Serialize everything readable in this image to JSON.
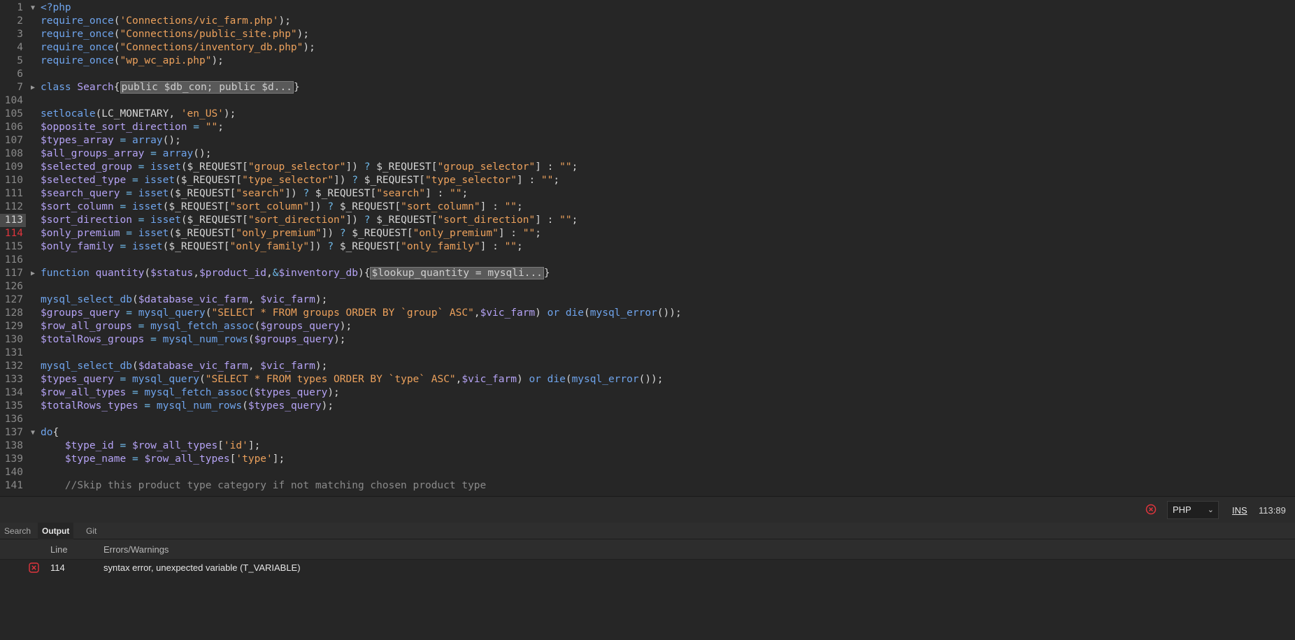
{
  "status_bar": {
    "language": "PHP",
    "mode": "INS",
    "cursor": "113:89"
  },
  "panel_tabs": [
    "Search",
    "Output",
    "Git"
  ],
  "output": {
    "headers": {
      "line": "Line",
      "message": "Errors/Warnings"
    },
    "rows": [
      {
        "line": "114",
        "message": "syntax error, unexpected variable (T_VARIABLE)"
      }
    ]
  },
  "colors": {
    "background": "#262626",
    "keyword": "#6fa4ec",
    "variable": "#b5a3f5",
    "string": "#eca15c",
    "error": "#e0353d"
  },
  "editor": {
    "active_line": "113",
    "error_line": "114",
    "lines": [
      {
        "n": "1",
        "fold": "open",
        "t": [
          [
            "k",
            "<?php"
          ]
        ]
      },
      {
        "n": "2",
        "t": [
          [
            "k",
            "require_once"
          ],
          [
            "p",
            "("
          ],
          [
            "s",
            "'Connections/vic_farm.php'"
          ],
          [
            "p",
            ");"
          ]
        ]
      },
      {
        "n": "3",
        "t": [
          [
            "k",
            "require_once"
          ],
          [
            "p",
            "("
          ],
          [
            "s",
            "\"Connections/public_site.php\""
          ],
          [
            "p",
            ");"
          ]
        ]
      },
      {
        "n": "4",
        "t": [
          [
            "k",
            "require_once"
          ],
          [
            "p",
            "("
          ],
          [
            "s",
            "\"Connections/inventory_db.php\""
          ],
          [
            "p",
            ");"
          ]
        ]
      },
      {
        "n": "5",
        "t": [
          [
            "k",
            "require_once"
          ],
          [
            "p",
            "("
          ],
          [
            "s",
            "\"wp_wc_api.php\""
          ],
          [
            "p",
            ");"
          ]
        ]
      },
      {
        "n": "6",
        "t": []
      },
      {
        "n": "7",
        "fold": "closed",
        "t": [
          [
            "k",
            "class "
          ],
          [
            "v",
            "Search"
          ],
          [
            "p",
            "{"
          ],
          [
            "box",
            "public $db_con; public $d..."
          ],
          [
            "p",
            "}"
          ]
        ]
      },
      {
        "n": "104",
        "t": []
      },
      {
        "n": "105",
        "t": [
          [
            "k",
            "setlocale"
          ],
          [
            "p",
            "(LC_MONETARY, "
          ],
          [
            "s",
            "'en_US'"
          ],
          [
            "p",
            ");"
          ]
        ]
      },
      {
        "n": "106",
        "t": [
          [
            "v",
            "$opposite_sort_direction"
          ],
          [
            "op",
            " = "
          ],
          [
            "s",
            "\"\""
          ],
          [
            "p",
            ";"
          ]
        ]
      },
      {
        "n": "107",
        "t": [
          [
            "v",
            "$types_array"
          ],
          [
            "op",
            " = "
          ],
          [
            "k",
            "array"
          ],
          [
            "p",
            "();"
          ]
        ]
      },
      {
        "n": "108",
        "t": [
          [
            "v",
            "$all_groups_array"
          ],
          [
            "op",
            " = "
          ],
          [
            "k",
            "array"
          ],
          [
            "p",
            "();"
          ]
        ]
      },
      {
        "n": "109",
        "t": [
          [
            "v",
            "$selected_group"
          ],
          [
            "op",
            " = "
          ],
          [
            "k",
            "isset"
          ],
          [
            "p",
            "($_REQUEST["
          ],
          [
            "s",
            "\"group_selector\""
          ],
          [
            "p",
            "]) "
          ],
          [
            "op",
            "? "
          ],
          [
            "p",
            "$_REQUEST["
          ],
          [
            "s",
            "\"group_selector\""
          ],
          [
            "p",
            "] : "
          ],
          [
            "s",
            "\"\""
          ],
          [
            "p",
            ";"
          ]
        ]
      },
      {
        "n": "110",
        "t": [
          [
            "v",
            "$selected_type"
          ],
          [
            "op",
            " = "
          ],
          [
            "k",
            "isset"
          ],
          [
            "p",
            "($_REQUEST["
          ],
          [
            "s",
            "\"type_selector\""
          ],
          [
            "p",
            "]) "
          ],
          [
            "op",
            "? "
          ],
          [
            "p",
            "$_REQUEST["
          ],
          [
            "s",
            "\"type_selector\""
          ],
          [
            "p",
            "] : "
          ],
          [
            "s",
            "\"\""
          ],
          [
            "p",
            ";"
          ]
        ]
      },
      {
        "n": "111",
        "t": [
          [
            "v",
            "$search_query"
          ],
          [
            "op",
            " = "
          ],
          [
            "k",
            "isset"
          ],
          [
            "p",
            "($_REQUEST["
          ],
          [
            "s",
            "\"search\""
          ],
          [
            "p",
            "]) "
          ],
          [
            "op",
            "? "
          ],
          [
            "p",
            "$_REQUEST["
          ],
          [
            "s",
            "\"search\""
          ],
          [
            "p",
            "] : "
          ],
          [
            "s",
            "\"\""
          ],
          [
            "p",
            ";"
          ]
        ]
      },
      {
        "n": "112",
        "t": [
          [
            "v",
            "$sort_column"
          ],
          [
            "op",
            " = "
          ],
          [
            "k",
            "isset"
          ],
          [
            "p",
            "($_REQUEST["
          ],
          [
            "s",
            "\"sort_column\""
          ],
          [
            "p",
            "]) "
          ],
          [
            "op",
            "? "
          ],
          [
            "p",
            "$_REQUEST["
          ],
          [
            "s",
            "\"sort_column\""
          ],
          [
            "p",
            "] : "
          ],
          [
            "s",
            "\"\""
          ],
          [
            "p",
            ";"
          ]
        ]
      },
      {
        "n": "113",
        "t": [
          [
            "v",
            "$sort_direction"
          ],
          [
            "op",
            " = "
          ],
          [
            "k",
            "isset"
          ],
          [
            "p",
            "($_REQUEST["
          ],
          [
            "s",
            "\"sort_direction\""
          ],
          [
            "p",
            "]) "
          ],
          [
            "op",
            "? "
          ],
          [
            "p",
            "$_REQUEST["
          ],
          [
            "s",
            "\"sort_direction\""
          ],
          [
            "p",
            "] : "
          ],
          [
            "s",
            "\"\""
          ],
          [
            "p",
            ";"
          ]
        ]
      },
      {
        "n": "114",
        "t": [
          [
            "v",
            "$only_premium"
          ],
          [
            "op",
            " = "
          ],
          [
            "k",
            "isset"
          ],
          [
            "p",
            "($_REQUEST["
          ],
          [
            "s",
            "\"only_premium\""
          ],
          [
            "p",
            "]) "
          ],
          [
            "op",
            "? "
          ],
          [
            "p",
            "$_REQUEST["
          ],
          [
            "s",
            "\"only_premium\""
          ],
          [
            "p",
            "] : "
          ],
          [
            "s",
            "\"\""
          ],
          [
            "p",
            ";"
          ]
        ]
      },
      {
        "n": "115",
        "t": [
          [
            "v",
            "$only_family"
          ],
          [
            "op",
            " = "
          ],
          [
            "k",
            "isset"
          ],
          [
            "p",
            "($_REQUEST["
          ],
          [
            "s",
            "\"only_family\""
          ],
          [
            "p",
            "]) "
          ],
          [
            "op",
            "? "
          ],
          [
            "p",
            "$_REQUEST["
          ],
          [
            "s",
            "\"only_family\""
          ],
          [
            "p",
            "] : "
          ],
          [
            "s",
            "\"\""
          ],
          [
            "p",
            ";"
          ]
        ]
      },
      {
        "n": "116",
        "t": []
      },
      {
        "n": "117",
        "fold": "closed",
        "t": [
          [
            "k",
            "function "
          ],
          [
            "v",
            "quantity"
          ],
          [
            "p",
            "("
          ],
          [
            "v",
            "$status"
          ],
          [
            "p",
            ","
          ],
          [
            "v",
            "$product_id"
          ],
          [
            "p",
            ","
          ],
          [
            "op",
            "&"
          ],
          [
            "v",
            "$inventory_db"
          ],
          [
            "p",
            "){"
          ],
          [
            "box",
            "$lookup_quantity = mysqli..."
          ],
          [
            "p",
            "}"
          ]
        ]
      },
      {
        "n": "126",
        "t": []
      },
      {
        "n": "127",
        "t": [
          [
            "k",
            "mysql_select_db"
          ],
          [
            "p",
            "("
          ],
          [
            "v",
            "$database_vic_farm"
          ],
          [
            "p",
            ", "
          ],
          [
            "v",
            "$vic_farm"
          ],
          [
            "p",
            ");"
          ]
        ]
      },
      {
        "n": "128",
        "t": [
          [
            "v",
            "$groups_query"
          ],
          [
            "op",
            " = "
          ],
          [
            "k",
            "mysql_query"
          ],
          [
            "p",
            "("
          ],
          [
            "s",
            "\"SELECT * FROM groups ORDER BY `group` ASC\""
          ],
          [
            "p",
            ","
          ],
          [
            "v",
            "$vic_farm"
          ],
          [
            "p",
            ") "
          ],
          [
            "k",
            "or die"
          ],
          [
            "p",
            "("
          ],
          [
            "k",
            "mysql_error"
          ],
          [
            "p",
            "());"
          ]
        ]
      },
      {
        "n": "129",
        "t": [
          [
            "v",
            "$row_all_groups"
          ],
          [
            "op",
            " = "
          ],
          [
            "k",
            "mysql_fetch_assoc"
          ],
          [
            "p",
            "("
          ],
          [
            "v",
            "$groups_query"
          ],
          [
            "p",
            ");"
          ]
        ]
      },
      {
        "n": "130",
        "t": [
          [
            "v",
            "$totalRows_groups"
          ],
          [
            "op",
            " = "
          ],
          [
            "k",
            "mysql_num_rows"
          ],
          [
            "p",
            "("
          ],
          [
            "v",
            "$groups_query"
          ],
          [
            "p",
            ");"
          ]
        ]
      },
      {
        "n": "131",
        "t": []
      },
      {
        "n": "132",
        "t": [
          [
            "k",
            "mysql_select_db"
          ],
          [
            "p",
            "("
          ],
          [
            "v",
            "$database_vic_farm"
          ],
          [
            "p",
            ", "
          ],
          [
            "v",
            "$vic_farm"
          ],
          [
            "p",
            ");"
          ]
        ]
      },
      {
        "n": "133",
        "t": [
          [
            "v",
            "$types_query"
          ],
          [
            "op",
            " = "
          ],
          [
            "k",
            "mysql_query"
          ],
          [
            "p",
            "("
          ],
          [
            "s",
            "\"SELECT * FROM types ORDER BY `type` ASC\""
          ],
          [
            "p",
            ","
          ],
          [
            "v",
            "$vic_farm"
          ],
          [
            "p",
            ") "
          ],
          [
            "k",
            "or die"
          ],
          [
            "p",
            "("
          ],
          [
            "k",
            "mysql_error"
          ],
          [
            "p",
            "());"
          ]
        ]
      },
      {
        "n": "134",
        "t": [
          [
            "v",
            "$row_all_types"
          ],
          [
            "op",
            " = "
          ],
          [
            "k",
            "mysql_fetch_assoc"
          ],
          [
            "p",
            "("
          ],
          [
            "v",
            "$types_query"
          ],
          [
            "p",
            ");"
          ]
        ]
      },
      {
        "n": "135",
        "t": [
          [
            "v",
            "$totalRows_types"
          ],
          [
            "op",
            " = "
          ],
          [
            "k",
            "mysql_num_rows"
          ],
          [
            "p",
            "("
          ],
          [
            "v",
            "$types_query"
          ],
          [
            "p",
            ");"
          ]
        ]
      },
      {
        "n": "136",
        "t": []
      },
      {
        "n": "137",
        "fold": "open",
        "t": [
          [
            "k",
            "do"
          ],
          [
            "p",
            "{"
          ]
        ]
      },
      {
        "n": "138",
        "t": [
          [
            "p",
            "    "
          ],
          [
            "v",
            "$type_id"
          ],
          [
            "op",
            " = "
          ],
          [
            "v",
            "$row_all_types"
          ],
          [
            "p",
            "["
          ],
          [
            "s",
            "'id'"
          ],
          [
            "p",
            "];"
          ]
        ]
      },
      {
        "n": "139",
        "t": [
          [
            "p",
            "    "
          ],
          [
            "v",
            "$type_name"
          ],
          [
            "op",
            " = "
          ],
          [
            "v",
            "$row_all_types"
          ],
          [
            "p",
            "["
          ],
          [
            "s",
            "'type'"
          ],
          [
            "p",
            "];"
          ]
        ]
      },
      {
        "n": "140",
        "t": []
      },
      {
        "n": "141",
        "t": [
          [
            "c",
            "    //Skip this product type category if not matching chosen product type"
          ]
        ]
      }
    ]
  }
}
